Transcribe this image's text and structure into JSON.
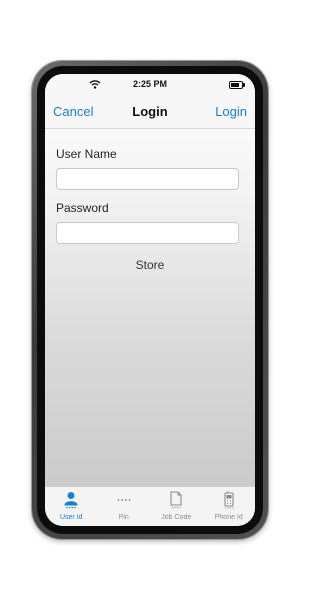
{
  "status_bar": {
    "time": "2:25 PM"
  },
  "nav_bar": {
    "cancel_label": "Cancel",
    "title": "Login",
    "login_label": "Login"
  },
  "form": {
    "username_label": "User Name",
    "username_value": "",
    "password_label": "Password",
    "password_value": "",
    "store_label": "Store"
  },
  "tabs": [
    {
      "label": "User Id",
      "icon": "user-icon",
      "active": true
    },
    {
      "label": "Pin",
      "icon": "pin-dots-icon",
      "active": false
    },
    {
      "label": "Job Code",
      "icon": "document-icon",
      "active": false
    },
    {
      "label": "Phone Id",
      "icon": "phone-icon",
      "active": false
    }
  ],
  "colors": {
    "accent": "#1a7fd1",
    "tab_inactive": "#8a8a8a"
  }
}
